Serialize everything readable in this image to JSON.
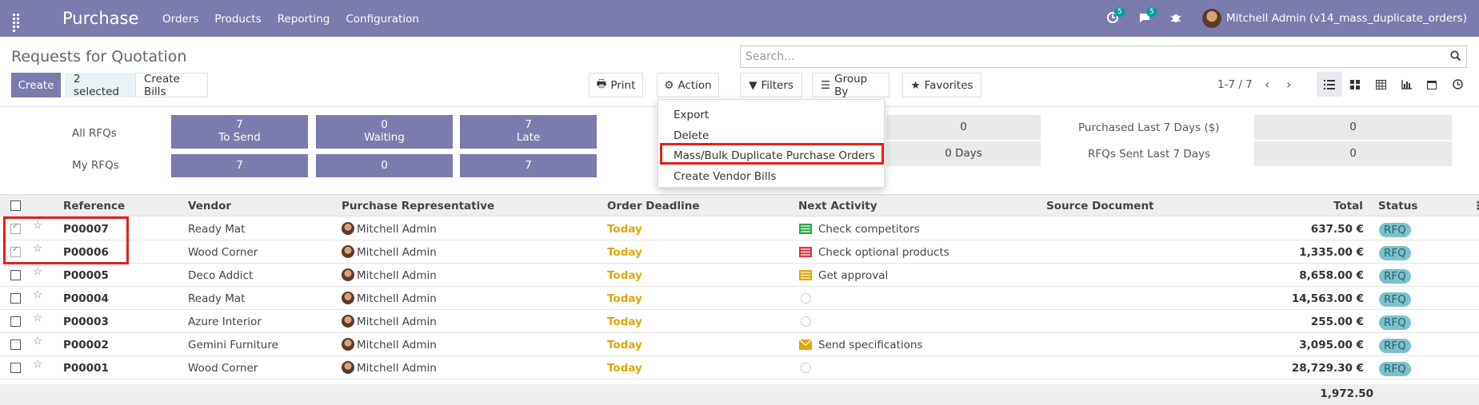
{
  "topbar": {
    "app": "Purchase",
    "menu": [
      "Orders",
      "Products",
      "Reporting",
      "Configuration"
    ],
    "activity_count": "5",
    "message_count": "5",
    "user": "Mitchell Admin (v14_mass_duplicate_orders)"
  },
  "control": {
    "title": "Requests for Quotation",
    "search_placeholder": "Search...",
    "create": "Create",
    "selected": "2 selected",
    "create_bills": "Create Bills",
    "print": "Print",
    "action": "Action",
    "filters": "Filters",
    "group_by": "Group By",
    "favorites": "Favorites",
    "pager": "1-7 / 7"
  },
  "dashboard": {
    "all_rfqs": "All RFQs",
    "my_rfqs": "My RFQs",
    "tiles_all": [
      {
        "value": "7",
        "label": "To Send"
      },
      {
        "value": "0",
        "label": "Waiting"
      },
      {
        "value": "7",
        "label": "Late"
      }
    ],
    "tiles_my": [
      "7",
      "0",
      "7"
    ],
    "avg_value": "0",
    "lead_time": "0  Days",
    "purchased_label": "Purchased Last 7 Days ($)",
    "purchased_value": "0",
    "sent_label": "RFQs Sent Last 7 Days",
    "sent_value": "0"
  },
  "action_menu": [
    "Export",
    "Delete",
    "Mass/Bulk Duplicate Purchase Orders",
    "Create Vendor Bills"
  ],
  "columns": [
    "Reference",
    "Vendor",
    "Purchase Representative",
    "Order Deadline",
    "Next Activity",
    "Source Document",
    "Total",
    "Status"
  ],
  "rows": [
    {
      "ref": "P00007",
      "vendor": "Ready Mat",
      "rep": "Mitchell Admin",
      "deadline": "Today",
      "activity": "Check competitors",
      "total": "637.50 €",
      "status": "RFQ"
    },
    {
      "ref": "P00006",
      "vendor": "Wood Corner",
      "rep": "Mitchell Admin",
      "deadline": "Today",
      "activity": "Check optional products",
      "total": "1,335.00 €",
      "status": "RFQ"
    },
    {
      "ref": "P00005",
      "vendor": "Deco Addict",
      "rep": "Mitchell Admin",
      "deadline": "Today",
      "activity": "Get approval",
      "total": "8,658.00 €",
      "status": "RFQ"
    },
    {
      "ref": "P00004",
      "vendor": "Ready Mat",
      "rep": "Mitchell Admin",
      "deadline": "Today",
      "activity": "",
      "total": "14,563.00 €",
      "status": "RFQ"
    },
    {
      "ref": "P00003",
      "vendor": "Azure Interior",
      "rep": "Mitchell Admin",
      "deadline": "Today",
      "activity": "",
      "total": "255.00 €",
      "status": "RFQ"
    },
    {
      "ref": "P00002",
      "vendor": "Gemini Furniture",
      "rep": "Mitchell Admin",
      "deadline": "Today",
      "activity": "Send specifications",
      "total": "3,095.00 €",
      "status": "RFQ"
    },
    {
      "ref": "P00001",
      "vendor": "Wood Corner",
      "rep": "Mitchell Admin",
      "deadline": "Today",
      "activity": "",
      "total": "28,729.30 €",
      "status": "RFQ"
    }
  ],
  "footer_total": "1,972.50"
}
